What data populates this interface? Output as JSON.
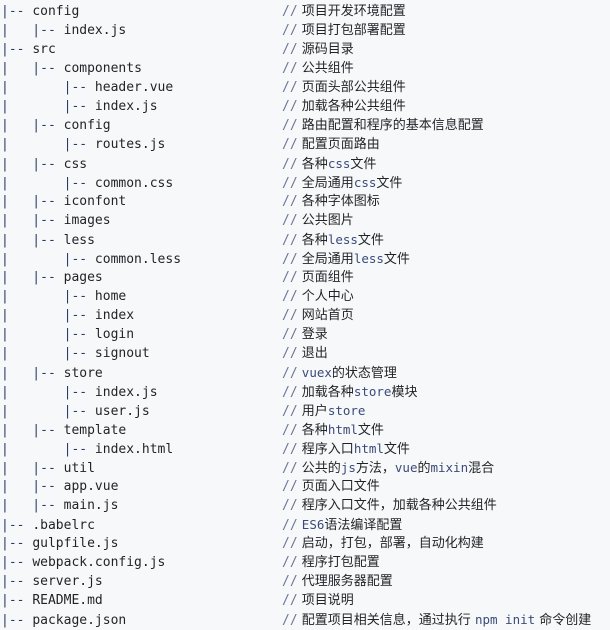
{
  "view": {
    "title": "Project Directory Structure",
    "background_color": "#f7f8f9",
    "text_color": "#1f2328",
    "branch_color": "#2b3a67",
    "comment_marker_color": "#6a7694",
    "code_token_color": "#3b4a7a",
    "comment_marker": "//",
    "branch_token": "|--",
    "pipe_token": "|"
  },
  "tree": {
    "lines": [
      {
        "indent": 0,
        "prefix": "|-- ",
        "name": "config",
        "comment_parts": [
          {
            "t": "text",
            "v": "项目开发环境配置"
          }
        ]
      },
      {
        "indent": 1,
        "prefix": "|   |-- ",
        "name": "index.js",
        "comment_parts": [
          {
            "t": "text",
            "v": "项目打包部署配置"
          }
        ]
      },
      {
        "indent": 0,
        "prefix": "|-- ",
        "name": "src",
        "comment_parts": [
          {
            "t": "text",
            "v": "源码目录"
          }
        ]
      },
      {
        "indent": 1,
        "prefix": "|   |-- ",
        "name": "components",
        "comment_parts": [
          {
            "t": "text",
            "v": "公共组件"
          }
        ]
      },
      {
        "indent": 2,
        "prefix": "|       |-- ",
        "name": "header.vue",
        "comment_parts": [
          {
            "t": "text",
            "v": "页面头部公共组件"
          }
        ]
      },
      {
        "indent": 2,
        "prefix": "|       |-- ",
        "name": "index.js",
        "comment_parts": [
          {
            "t": "text",
            "v": "加载各种公共组件"
          }
        ]
      },
      {
        "indent": 1,
        "prefix": "|   |-- ",
        "name": "config",
        "comment_parts": [
          {
            "t": "text",
            "v": "路由配置和程序的基本信息配置"
          }
        ]
      },
      {
        "indent": 2,
        "prefix": "|       |-- ",
        "name": "routes.js",
        "comment_parts": [
          {
            "t": "text",
            "v": "配置页面路由"
          }
        ]
      },
      {
        "indent": 1,
        "prefix": "|   |-- ",
        "name": "css",
        "comment_parts": [
          {
            "t": "text",
            "v": "各种"
          },
          {
            "t": "code",
            "v": "css"
          },
          {
            "t": "text",
            "v": "文件"
          }
        ]
      },
      {
        "indent": 2,
        "prefix": "|       |-- ",
        "name": "common.css",
        "comment_parts": [
          {
            "t": "text",
            "v": "全局通用"
          },
          {
            "t": "code",
            "v": "css"
          },
          {
            "t": "text",
            "v": "文件"
          }
        ]
      },
      {
        "indent": 1,
        "prefix": "|   |-- ",
        "name": "iconfont",
        "comment_parts": [
          {
            "t": "text",
            "v": "各种字体图标"
          }
        ]
      },
      {
        "indent": 1,
        "prefix": "|   |-- ",
        "name": "images",
        "comment_parts": [
          {
            "t": "text",
            "v": "公共图片"
          }
        ]
      },
      {
        "indent": 1,
        "prefix": "|   |-- ",
        "name": "less",
        "comment_parts": [
          {
            "t": "text",
            "v": "各种"
          },
          {
            "t": "code",
            "v": "less"
          },
          {
            "t": "text",
            "v": "文件"
          }
        ]
      },
      {
        "indent": 2,
        "prefix": "|       |-- ",
        "name": "common.less",
        "comment_parts": [
          {
            "t": "text",
            "v": "全局通用"
          },
          {
            "t": "code",
            "v": "less"
          },
          {
            "t": "text",
            "v": "文件"
          }
        ]
      },
      {
        "indent": 1,
        "prefix": "|   |-- ",
        "name": "pages",
        "comment_parts": [
          {
            "t": "text",
            "v": "页面组件"
          }
        ]
      },
      {
        "indent": 2,
        "prefix": "|       |-- ",
        "name": "home",
        "comment_parts": [
          {
            "t": "text",
            "v": "个人中心"
          }
        ]
      },
      {
        "indent": 2,
        "prefix": "|       |-- ",
        "name": "index",
        "comment_parts": [
          {
            "t": "text",
            "v": "网站首页"
          }
        ]
      },
      {
        "indent": 2,
        "prefix": "|       |-- ",
        "name": "login",
        "comment_parts": [
          {
            "t": "text",
            "v": "登录"
          }
        ]
      },
      {
        "indent": 2,
        "prefix": "|       |-- ",
        "name": "signout",
        "comment_parts": [
          {
            "t": "text",
            "v": "退出"
          }
        ]
      },
      {
        "indent": 1,
        "prefix": "|   |-- ",
        "name": "store",
        "comment_parts": [
          {
            "t": "code",
            "v": "vuex"
          },
          {
            "t": "text",
            "v": "的状态管理"
          }
        ]
      },
      {
        "indent": 2,
        "prefix": "|       |-- ",
        "name": "index.js",
        "comment_parts": [
          {
            "t": "text",
            "v": "加载各种"
          },
          {
            "t": "code",
            "v": "store"
          },
          {
            "t": "text",
            "v": "模块"
          }
        ]
      },
      {
        "indent": 2,
        "prefix": "|       |-- ",
        "name": "user.js",
        "comment_parts": [
          {
            "t": "text",
            "v": "用户"
          },
          {
            "t": "code",
            "v": "store"
          }
        ]
      },
      {
        "indent": 1,
        "prefix": "|   |-- ",
        "name": "template",
        "comment_parts": [
          {
            "t": "text",
            "v": "各种"
          },
          {
            "t": "code",
            "v": "html"
          },
          {
            "t": "text",
            "v": "文件"
          }
        ]
      },
      {
        "indent": 2,
        "prefix": "|       |-- ",
        "name": "index.html",
        "comment_parts": [
          {
            "t": "text",
            "v": "程序入口"
          },
          {
            "t": "code",
            "v": "html"
          },
          {
            "t": "text",
            "v": "文件"
          }
        ]
      },
      {
        "indent": 1,
        "prefix": "|   |-- ",
        "name": "util",
        "comment_parts": [
          {
            "t": "text",
            "v": "公共的"
          },
          {
            "t": "code",
            "v": "js"
          },
          {
            "t": "text",
            "v": "方法，"
          },
          {
            "t": "code",
            "v": "vue"
          },
          {
            "t": "text",
            "v": "的"
          },
          {
            "t": "code",
            "v": "mixin"
          },
          {
            "t": "text",
            "v": "混合"
          }
        ]
      },
      {
        "indent": 1,
        "prefix": "|   |-- ",
        "name": "app.vue",
        "comment_parts": [
          {
            "t": "text",
            "v": "页面入口文件"
          }
        ]
      },
      {
        "indent": 1,
        "prefix": "|   |-- ",
        "name": "main.js",
        "comment_parts": [
          {
            "t": "text",
            "v": "程序入口文件，加载各种公共组件"
          }
        ]
      },
      {
        "indent": 0,
        "prefix": "|-- ",
        "name": ".babelrc",
        "comment_parts": [
          {
            "t": "code",
            "v": "ES6"
          },
          {
            "t": "text",
            "v": "语法编译配置"
          }
        ]
      },
      {
        "indent": 0,
        "prefix": "|-- ",
        "name": "gulpfile.js",
        "comment_parts": [
          {
            "t": "text",
            "v": "启动，打包，部署，自动化构建"
          }
        ]
      },
      {
        "indent": 0,
        "prefix": "|-- ",
        "name": "webpack.config.js",
        "comment_parts": [
          {
            "t": "text",
            "v": "程序打包配置"
          }
        ]
      },
      {
        "indent": 0,
        "prefix": "|-- ",
        "name": "server.js",
        "comment_parts": [
          {
            "t": "text",
            "v": "代理服务器配置"
          }
        ]
      },
      {
        "indent": 0,
        "prefix": "|-- ",
        "name": "README.md",
        "comment_parts": [
          {
            "t": "text",
            "v": "项目说明"
          }
        ]
      },
      {
        "indent": 0,
        "prefix": "|-- ",
        "name": "package.json",
        "comment_parts": [
          {
            "t": "text",
            "v": "配置项目相关信息，通过执行 "
          },
          {
            "t": "code",
            "v": "npm init"
          },
          {
            "t": "text",
            "v": " 命令创建"
          }
        ]
      }
    ]
  }
}
